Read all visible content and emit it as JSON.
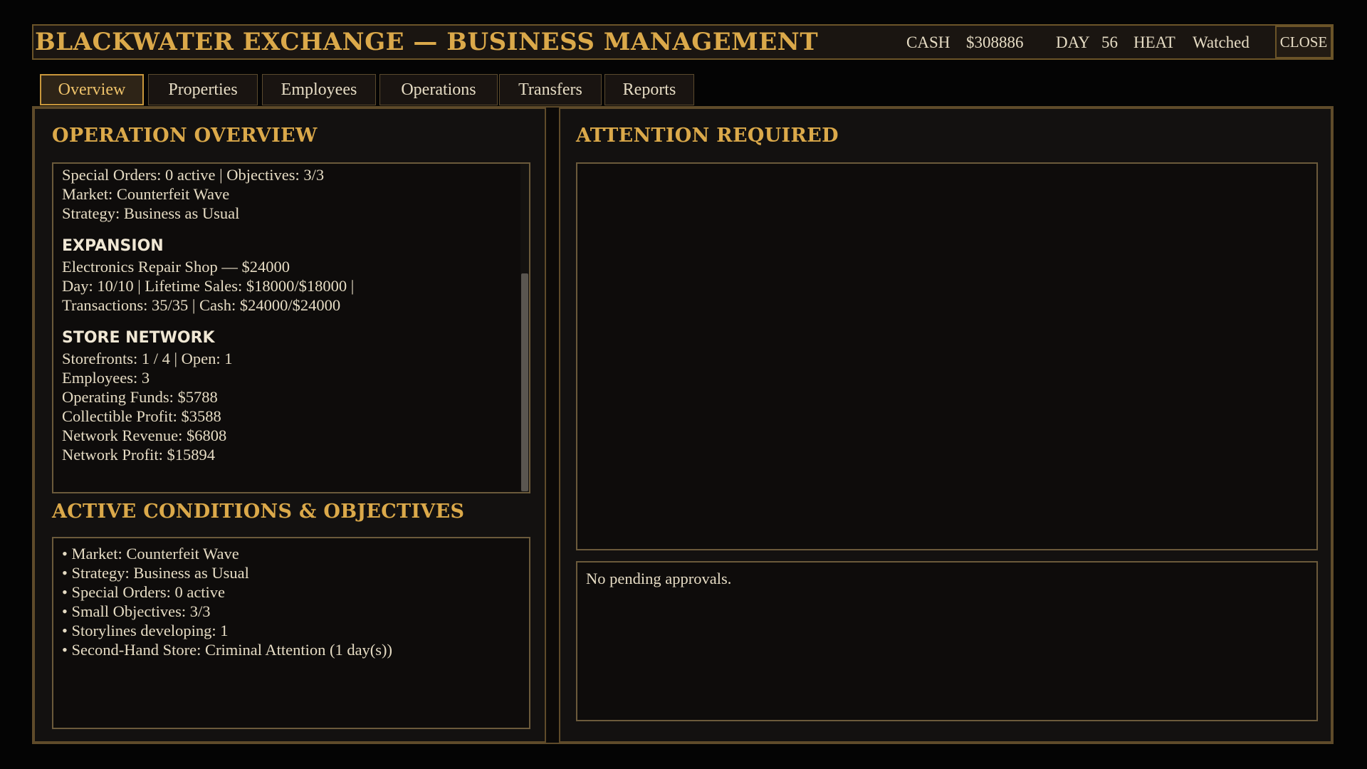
{
  "header": {
    "title": "BLACKWATER EXCHANGE — BUSINESS MANAGEMENT",
    "cash_label": "CASH",
    "cash_value": "$308886",
    "day_label": "DAY",
    "day_value": "56",
    "heat_label": "HEAT",
    "heat_value": "Watched",
    "close_label": "CLOSE"
  },
  "tabs": [
    {
      "label": "Overview",
      "active": true
    },
    {
      "label": "Properties",
      "active": false
    },
    {
      "label": "Employees",
      "active": false
    },
    {
      "label": "Operations",
      "active": false
    },
    {
      "label": "Transfers",
      "active": false
    },
    {
      "label": "Reports",
      "active": false
    }
  ],
  "overview": {
    "title": "OPERATION OVERVIEW",
    "summary_lines": [
      "Special Orders: 0 active  |  Objectives: 3/3",
      "Market: Counterfeit Wave",
      "Strategy: Business as Usual"
    ],
    "expansion": {
      "heading": "EXPANSION",
      "lines": [
        "Electronics Repair Shop — $24000",
        "Day: 10/10  |  Lifetime Sales: $18000/$18000  |",
        "Transactions: 35/35  |  Cash: $24000/$24000"
      ]
    },
    "store_network": {
      "heading": "STORE NETWORK",
      "lines": [
        "Storefronts: 1 / 4  |  Open: 1",
        "Employees: 3",
        "Operating Funds: $5788",
        "Collectible Profit: $3588",
        "Network Revenue: $6808",
        "Network Profit: $15894"
      ]
    }
  },
  "conditions": {
    "title": "ACTIVE CONDITIONS & OBJECTIVES",
    "items": [
      "• Market: Counterfeit Wave",
      "• Strategy: Business as Usual",
      "• Special Orders: 0 active",
      "• Small Objectives: 3/3",
      "• Storylines developing: 1",
      "• Second-Hand Store: Criminal Attention (1 day(s))"
    ]
  },
  "attention": {
    "title": "ATTENTION REQUIRED",
    "approvals_text": "No pending approvals."
  }
}
